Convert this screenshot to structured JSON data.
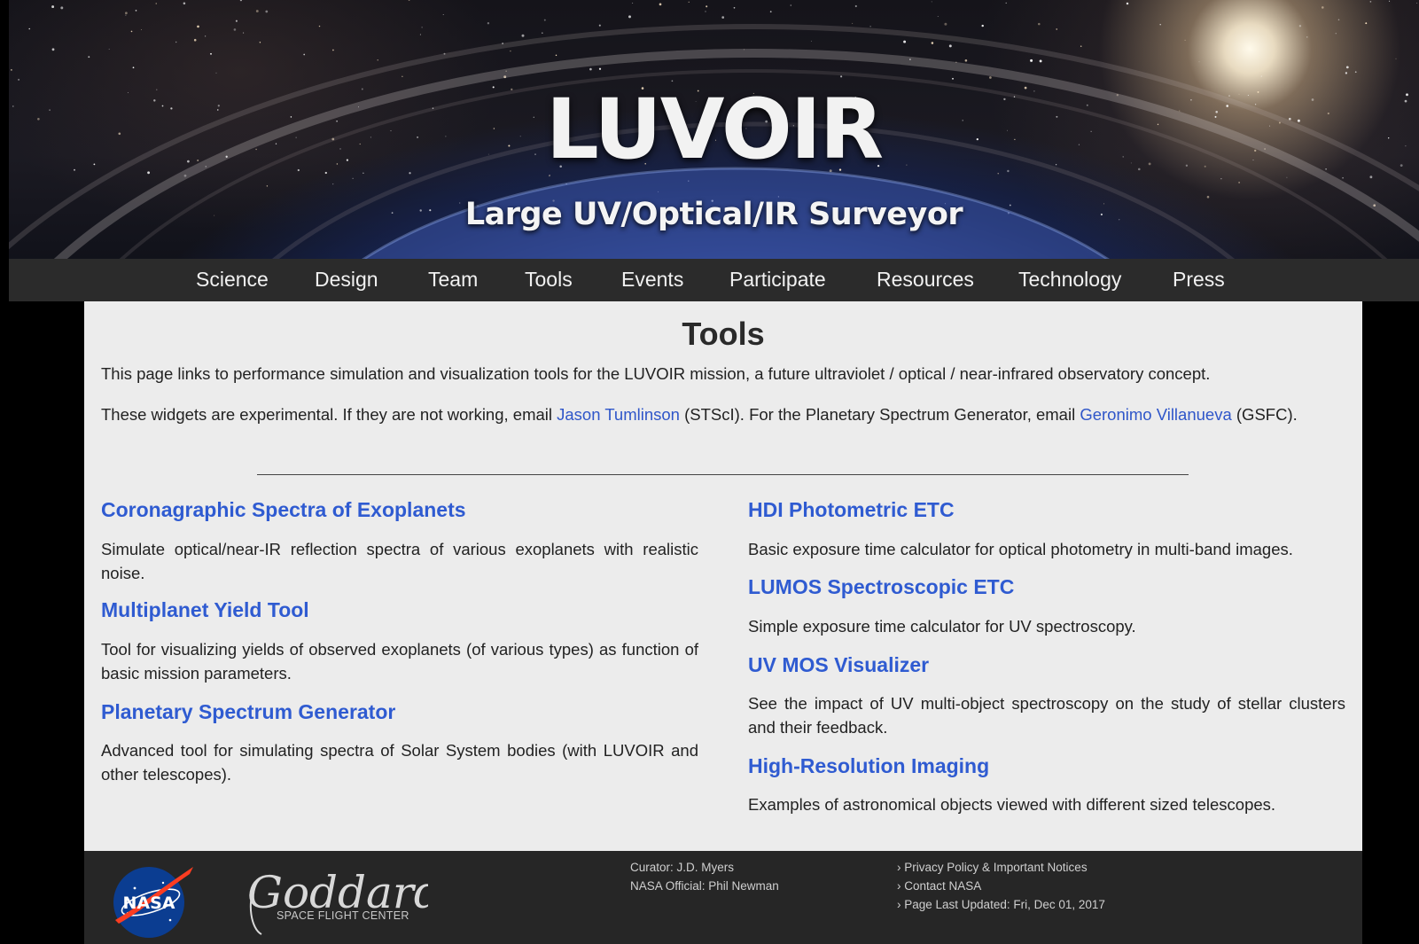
{
  "banner": {
    "title": "LUVOIR",
    "subtitle": "Large UV/Optical/IR Surveyor"
  },
  "nav": {
    "items": [
      "Science",
      "Design",
      "Team",
      "Tools",
      "Events",
      "Participate",
      "Resources",
      "Technology",
      "Press"
    ]
  },
  "main": {
    "title": "Tools",
    "intro1": "This page links to performance simulation and visualization tools for the LUVOIR mission, a future ultraviolet / optical / near-infrared observatory concept.",
    "intro2": {
      "pre": "These widgets are experimental. If they are not working, email ",
      "link1": "Jason Tumlinson",
      "mid": " (STScI). For the Planetary Spectrum Generator, email ",
      "link2": "Geronimo Villanueva",
      "post": " (GSFC)."
    },
    "left_tools": [
      {
        "title": "Coronagraphic Spectra of Exoplanets",
        "desc": "Simulate optical/near-IR reflection spectra of various exoplanets with realistic noise."
      },
      {
        "title": "Multiplanet Yield Tool",
        "desc": "Tool for visualizing yields of observed exoplanets (of various types) as function of basic mission parameters."
      },
      {
        "title": "Planetary Spectrum Generator",
        "desc": "Advanced tool for simulating spectra of Solar System bodies (with LUVOIR and other telescopes)."
      }
    ],
    "right_tools": [
      {
        "title": "HDI Photometric ETC",
        "desc": "Basic exposure time calculator for optical photometry in multi-band images."
      },
      {
        "title": "LUMOS Spectroscopic ETC",
        "desc": "Simple exposure time calculator for UV spectroscopy."
      },
      {
        "title": "UV MOS Visualizer",
        "desc": "See the impact of UV multi-object spectroscopy on the study of stellar clusters and their feedback."
      },
      {
        "title": "High-Resolution Imaging",
        "desc": "Examples of astronomical objects viewed with different sized telescopes."
      }
    ]
  },
  "footer": {
    "nasa_logo_text": "NASA",
    "goddard_script": "Goddard",
    "goddard_sub": "SPACE FLIGHT CENTER",
    "curator": "Curator: J.D. Myers",
    "official": "NASA Official: Phil Newman",
    "privacy": "› Privacy Policy & Important Notices",
    "contact": "› Contact NASA",
    "updated": "› Page Last Updated: Fri, Dec 01, 2017"
  },
  "colors": {
    "link": "#2f5bd1",
    "nav_bg": "#2b2b2b",
    "content_bg": "#ececec",
    "footer_bg": "#262626"
  }
}
